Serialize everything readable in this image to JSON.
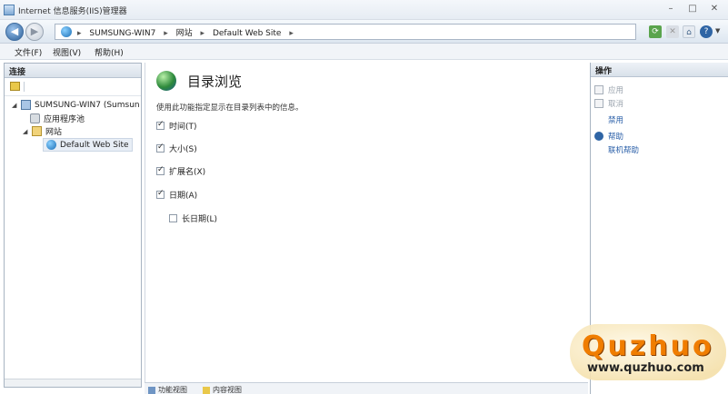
{
  "window": {
    "title": "Internet 信息服务(IIS)管理器",
    "controls": {
      "minimize": "–",
      "maximize": "□",
      "close": "✕"
    }
  },
  "address": {
    "breadcrumbs": [
      "SUMSUNG-WIN7",
      "网站",
      "Default Web Site"
    ],
    "separator": "▸"
  },
  "menu": {
    "items": [
      "文件(F)",
      "视图(V)",
      "帮助(H)"
    ]
  },
  "left_panel": {
    "header": "连接",
    "tree": {
      "server": "SUMSUNG-WIN7 (Sumsun",
      "app_pools": "应用程序池",
      "sites": "网站",
      "site": "Default Web Site"
    }
  },
  "center": {
    "title": "目录浏览",
    "description": "使用此功能指定显示在目录列表中的信息。",
    "options": [
      {
        "label": "时间(T)",
        "checked": true
      },
      {
        "label": "大小(S)",
        "checked": true
      },
      {
        "label": "扩展名(X)",
        "checked": true
      },
      {
        "label": "日期(A)",
        "checked": true
      },
      {
        "label": "长日期(L)",
        "checked": false
      }
    ],
    "bottom_tabs": [
      "功能视图",
      "内容视图"
    ]
  },
  "right_panel": {
    "header": "操作",
    "actions": [
      {
        "label": "应用",
        "enabled": false
      },
      {
        "label": "取消",
        "enabled": false
      },
      {
        "label": "禁用",
        "enabled": true
      },
      {
        "label": "帮助",
        "enabled": true
      },
      {
        "label": "联机帮助",
        "enabled": true
      }
    ]
  },
  "watermark": {
    "logo": "Quzhuo",
    "url": "www.quzhuo.com"
  },
  "colors": {
    "accent": "#2a5fa8",
    "watermark_orange": "#f07d00"
  }
}
